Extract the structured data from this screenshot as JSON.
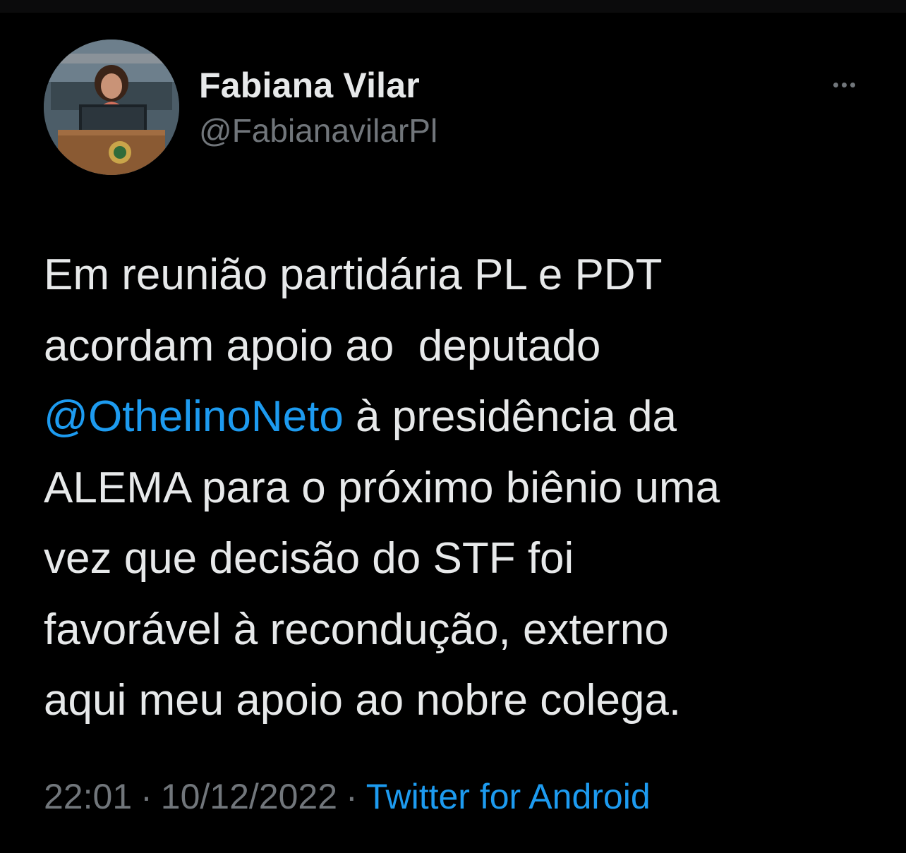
{
  "author": {
    "display_name": "Fabiana Vilar",
    "handle": "@FabianavilarPl",
    "avatar_icon": "profile-photo"
  },
  "tweet": {
    "line1": "Em reunião partidária PL e PDT",
    "line2": "acordam apoio ao  deputado",
    "mention": "@OthelinoNeto",
    "line3_rest": " à presidência da",
    "line4": "ALEMA para o próximo biênio uma",
    "line5": "vez que decisão do STF foi",
    "line6": "favorável à recondução, externo",
    "line7": "aqui meu apoio ao nobre colega."
  },
  "meta": {
    "time": "22:01",
    "separator": "·",
    "date": "10/12/2022",
    "source": "Twitter for Android"
  },
  "colors": {
    "background": "#000000",
    "primary_text": "#e7e9ea",
    "secondary_text": "#71767b",
    "accent": "#1d9bf0"
  },
  "icons": {
    "more": "more-horizontal-icon"
  }
}
